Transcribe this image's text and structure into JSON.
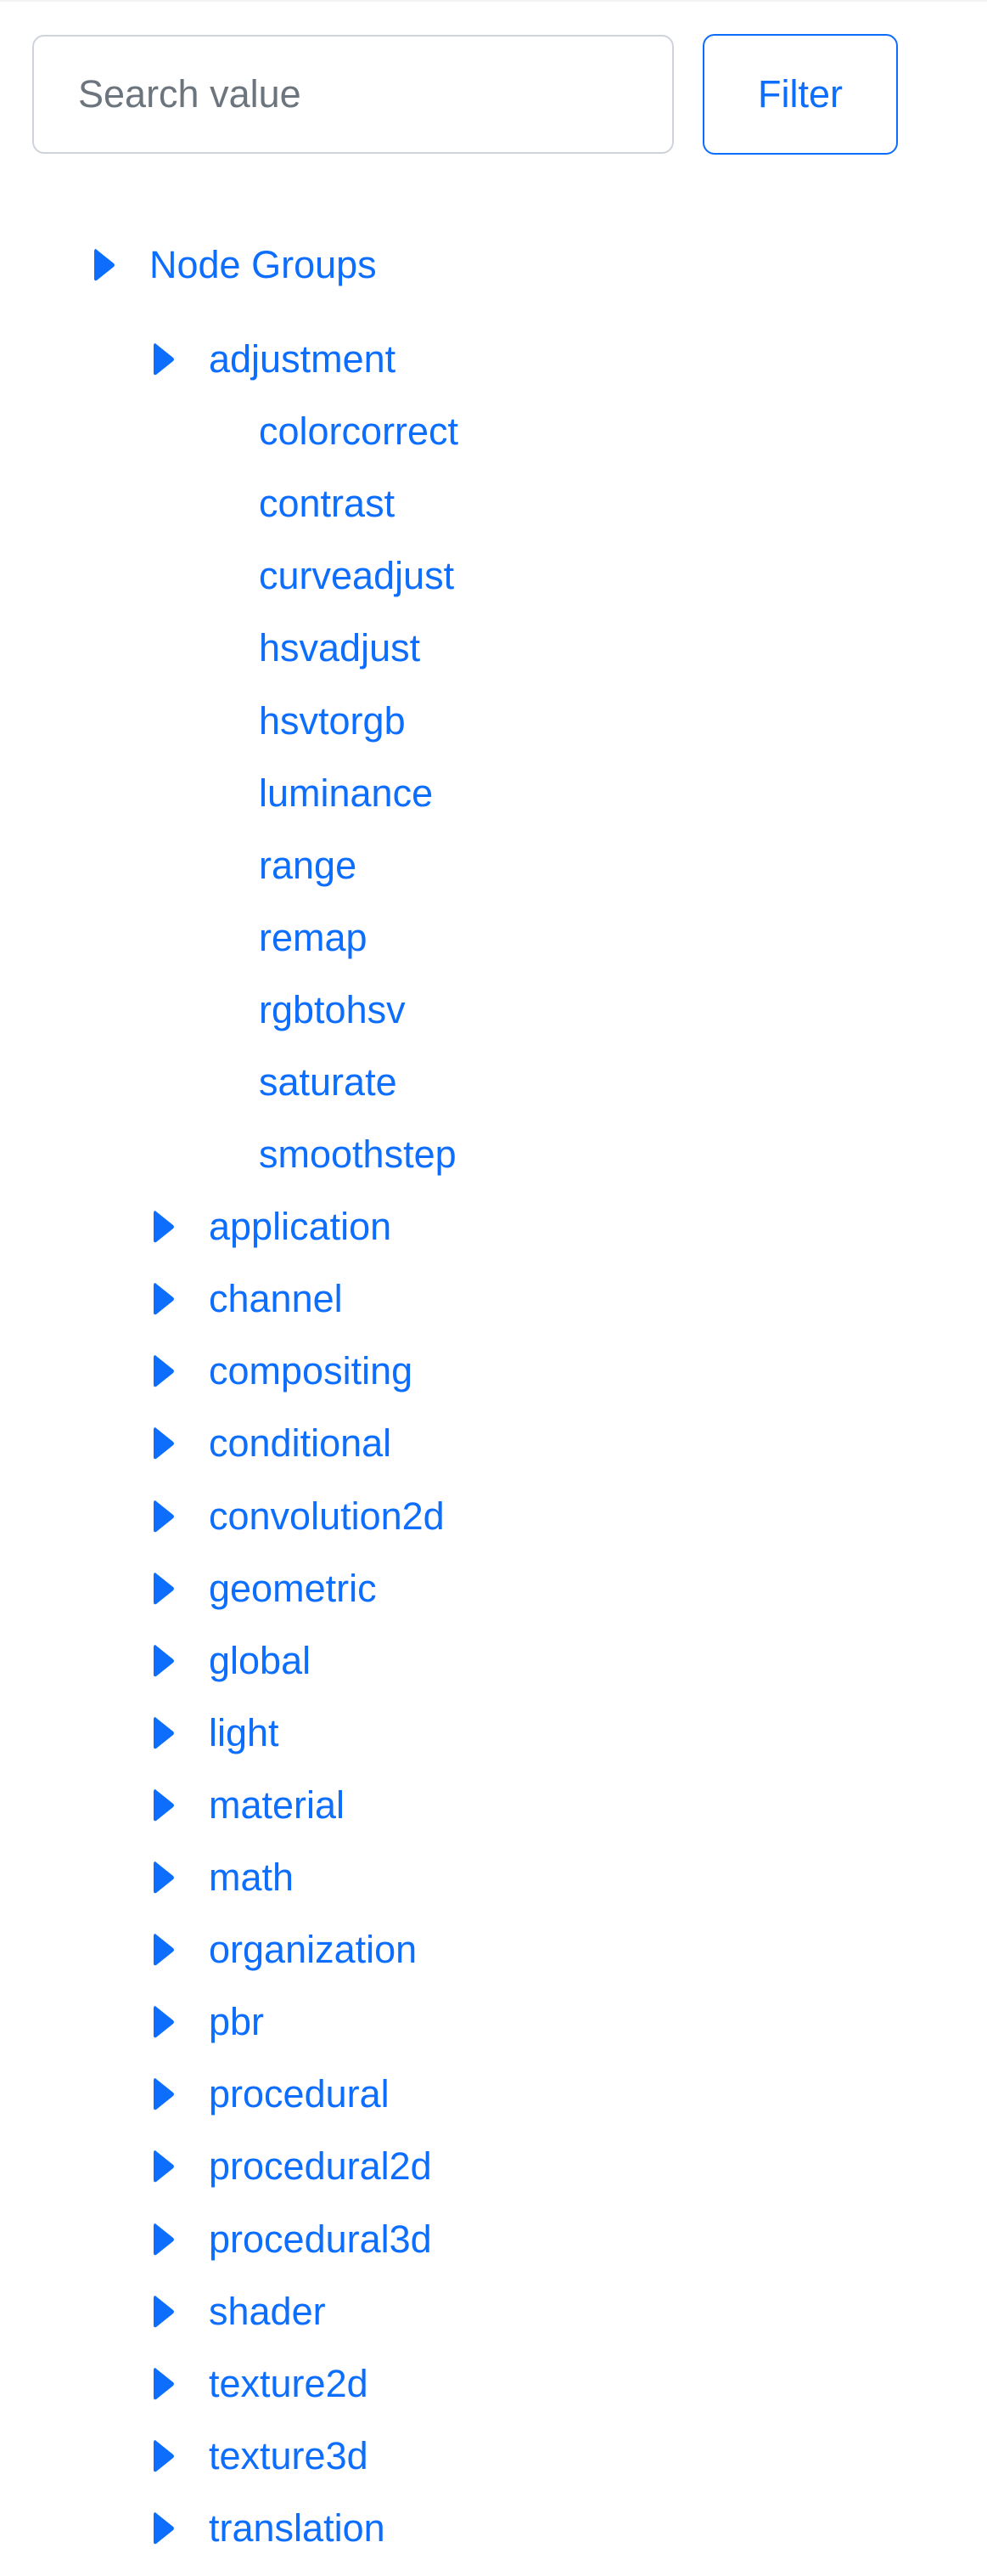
{
  "search": {
    "placeholder": "Search value",
    "value": ""
  },
  "filter_button": {
    "label": "Filter"
  },
  "colors": {
    "link": "#0d6efd",
    "input_border": "#ced4da",
    "placeholder": "#6c757d"
  },
  "tree": {
    "root": {
      "label": "Node Groups",
      "icon": "caret-right-icon",
      "expanded": true
    },
    "groups": [
      {
        "label": "adjustment",
        "icon": "caret-right-icon",
        "expanded": true,
        "children": [
          "colorcorrect",
          "contrast",
          "curveadjust",
          "hsvadjust",
          "hsvtorgb",
          "luminance",
          "range",
          "remap",
          "rgbtohsv",
          "saturate",
          "smoothstep"
        ]
      },
      {
        "label": "application",
        "icon": "caret-right-icon",
        "expanded": false
      },
      {
        "label": "channel",
        "icon": "caret-right-icon",
        "expanded": false
      },
      {
        "label": "compositing",
        "icon": "caret-right-icon",
        "expanded": false
      },
      {
        "label": "conditional",
        "icon": "caret-right-icon",
        "expanded": false
      },
      {
        "label": "convolution2d",
        "icon": "caret-right-icon",
        "expanded": false
      },
      {
        "label": "geometric",
        "icon": "caret-right-icon",
        "expanded": false
      },
      {
        "label": "global",
        "icon": "caret-right-icon",
        "expanded": false
      },
      {
        "label": "light",
        "icon": "caret-right-icon",
        "expanded": false
      },
      {
        "label": "material",
        "icon": "caret-right-icon",
        "expanded": false
      },
      {
        "label": "math",
        "icon": "caret-right-icon",
        "expanded": false
      },
      {
        "label": "organization",
        "icon": "caret-right-icon",
        "expanded": false
      },
      {
        "label": "pbr",
        "icon": "caret-right-icon",
        "expanded": false
      },
      {
        "label": "procedural",
        "icon": "caret-right-icon",
        "expanded": false
      },
      {
        "label": "procedural2d",
        "icon": "caret-right-icon",
        "expanded": false
      },
      {
        "label": "procedural3d",
        "icon": "caret-right-icon",
        "expanded": false
      },
      {
        "label": "shader",
        "icon": "caret-right-icon",
        "expanded": false
      },
      {
        "label": "texture2d",
        "icon": "caret-right-icon",
        "expanded": false
      },
      {
        "label": "texture3d",
        "icon": "caret-right-icon",
        "expanded": false
      },
      {
        "label": "translation",
        "icon": "caret-right-icon",
        "expanded": false
      }
    ]
  }
}
